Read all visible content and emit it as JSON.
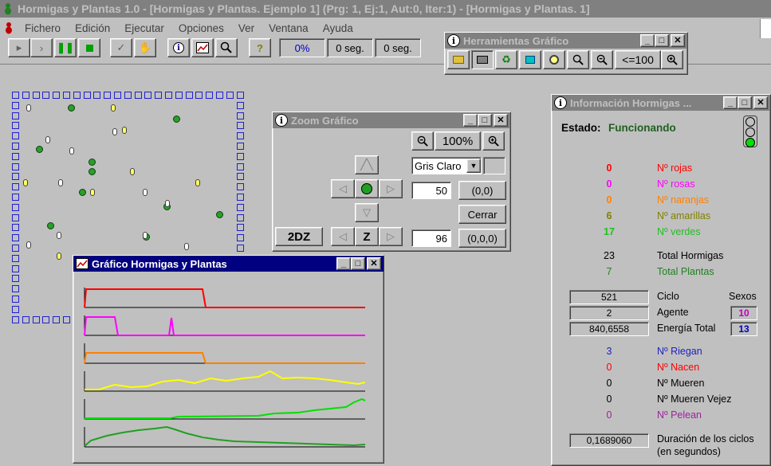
{
  "app": {
    "title": "Hormigas y Plantas 1.0 - [Hormigas y Plantas. Ejemplo 1] (Prg: 1, Ej:1, Aut:0, Iter:1) - [Hormigas y Plantas. 1]"
  },
  "menu": [
    {
      "label": "Fichero"
    },
    {
      "label": "Edición"
    },
    {
      "label": "Ejecutar"
    },
    {
      "label": "Opciones"
    },
    {
      "label": "Ver"
    },
    {
      "label": "Ventana"
    },
    {
      "label": "Ayuda"
    }
  ],
  "toolbar": {
    "progress": "0%",
    "time1": "0 seg.",
    "time2": "0 seg."
  },
  "herramientas": {
    "title": "Herramientas Gráfico",
    "limit_label": "<=100"
  },
  "zoom": {
    "title": "Zoom Gráfico",
    "zoom_level": "100%",
    "palette": "Gris Claro",
    "value_a": "50",
    "coord_a": "(0,0)",
    "close_label": "Cerrar",
    "mode_label": "2DZ",
    "z_label": "Z",
    "value_b": "96",
    "coord_b": "(0,0,0)"
  },
  "grafico": {
    "title": "Gráfico Hormigas y Plantas"
  },
  "info": {
    "title": "Información Hormigas ...",
    "estado_label": "Estado:",
    "estado_value": "Funcionando",
    "counts": [
      {
        "value": "0",
        "label": "Nº rojas",
        "color": "#ff0000"
      },
      {
        "value": "0",
        "label": "Nº rosas",
        "color": "#ff00ff"
      },
      {
        "value": "0",
        "label": "Nº naranjas",
        "color": "#ff8000"
      },
      {
        "value": "6",
        "label": "Nº amarillas",
        "color": "#808000"
      },
      {
        "value": "17",
        "label": "Nº verdes",
        "color": "#20c020"
      }
    ],
    "total_hormigas": {
      "value": "23",
      "label": "Total Hormigas"
    },
    "total_plantas": {
      "value": "7",
      "label": "Total Plantas"
    },
    "ciclo": {
      "value": "521",
      "label": "Ciclo"
    },
    "agente": {
      "value": "2",
      "label": "Agente"
    },
    "energia": {
      "value": "840,6558",
      "label": "Energía Total"
    },
    "sexos_label": "Sexos",
    "sexo_a": "10",
    "sexo_b": "13",
    "events": [
      {
        "value": "3",
        "label": "Nº Riegan",
        "color": "#2020c0"
      },
      {
        "value": "0",
        "label": "Nº Nacen",
        "color": "#ff0000"
      },
      {
        "value": "0",
        "label": "Nº Mueren",
        "color": "#000000"
      },
      {
        "value": "0",
        "label": "Nº Mueren Vejez",
        "color": "#000000"
      },
      {
        "value": "0",
        "label": "Nº Pelean",
        "color": "#a020a0"
      }
    ],
    "duracion": {
      "value": "0,1689060",
      "label1": "Duración de los ciclos",
      "label2": "(en segundos)"
    }
  }
}
